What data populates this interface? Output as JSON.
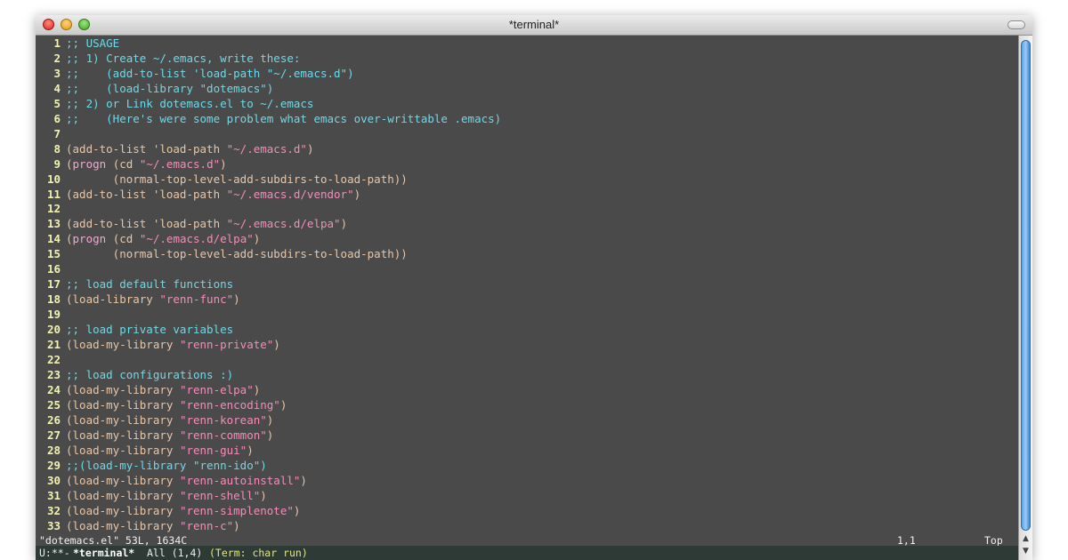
{
  "window": {
    "title": "*terminal*"
  },
  "lines": [
    {
      "n": "1",
      "segs": [
        {
          "t": ";; USAGE",
          "k": "c"
        }
      ]
    },
    {
      "n": "2",
      "segs": [
        {
          "t": ";; 1) Create ~/.emacs, write these:",
          "k": "c"
        }
      ]
    },
    {
      "n": "3",
      "segs": [
        {
          "t": ";;    (add-to-list 'load-path \"~/.emacs.d\")",
          "k": "c"
        }
      ]
    },
    {
      "n": "4",
      "segs": [
        {
          "t": ";;    (load-library \"dotemacs\")",
          "k": "c"
        }
      ]
    },
    {
      "n": "5",
      "segs": [
        {
          "t": ";; 2) or Link dotemacs.el to ~/.emacs",
          "k": "c"
        }
      ]
    },
    {
      "n": "6",
      "segs": [
        {
          "t": ";;    (Here's were some problem what emacs over-writtable .emacs)",
          "k": "c"
        }
      ]
    },
    {
      "n": "7",
      "segs": []
    },
    {
      "n": "8",
      "segs": [
        {
          "t": "(add-to-list 'load-path ",
          "k": "p"
        },
        {
          "t": "\"~/.emacs.d\"",
          "k": "s"
        },
        {
          "t": ")",
          "k": "p"
        }
      ]
    },
    {
      "n": "9",
      "segs": [
        {
          "t": "(",
          "k": "p"
        },
        {
          "t": "progn",
          "k": "k"
        },
        {
          "t": " (cd ",
          "k": "p"
        },
        {
          "t": "\"~/.emacs.d\"",
          "k": "s"
        },
        {
          "t": ")",
          "k": "p"
        }
      ]
    },
    {
      "n": "10",
      "segs": [
        {
          "t": "       (normal-top-level-add-subdirs-to-load-path))",
          "k": "p"
        }
      ]
    },
    {
      "n": "11",
      "segs": [
        {
          "t": "(add-to-list 'load-path ",
          "k": "p"
        },
        {
          "t": "\"~/.emacs.d/vendor\"",
          "k": "s"
        },
        {
          "t": ")",
          "k": "p"
        }
      ]
    },
    {
      "n": "12",
      "segs": []
    },
    {
      "n": "13",
      "segs": [
        {
          "t": "(add-to-list 'load-path ",
          "k": "p"
        },
        {
          "t": "\"~/.emacs.d/elpa\"",
          "k": "s"
        },
        {
          "t": ")",
          "k": "p"
        }
      ]
    },
    {
      "n": "14",
      "segs": [
        {
          "t": "(",
          "k": "p"
        },
        {
          "t": "progn",
          "k": "k"
        },
        {
          "t": " (cd ",
          "k": "p"
        },
        {
          "t": "\"~/.emacs.d/elpa\"",
          "k": "s"
        },
        {
          "t": ")",
          "k": "p"
        }
      ]
    },
    {
      "n": "15",
      "segs": [
        {
          "t": "       (normal-top-level-add-subdirs-to-load-path))",
          "k": "p"
        }
      ]
    },
    {
      "n": "16",
      "segs": []
    },
    {
      "n": "17",
      "segs": [
        {
          "t": ";; load default functions",
          "k": "c"
        }
      ]
    },
    {
      "n": "18",
      "segs": [
        {
          "t": "(load-library ",
          "k": "p"
        },
        {
          "t": "\"renn-func\"",
          "k": "s"
        },
        {
          "t": ")",
          "k": "p"
        }
      ]
    },
    {
      "n": "19",
      "segs": []
    },
    {
      "n": "20",
      "segs": [
        {
          "t": ";; load private variables",
          "k": "c"
        }
      ]
    },
    {
      "n": "21",
      "segs": [
        {
          "t": "(load-my-library ",
          "k": "p"
        },
        {
          "t": "\"renn-private\"",
          "k": "s"
        },
        {
          "t": ")",
          "k": "p"
        }
      ]
    },
    {
      "n": "22",
      "segs": []
    },
    {
      "n": "23",
      "segs": [
        {
          "t": ";; load configurations :)",
          "k": "c"
        }
      ]
    },
    {
      "n": "24",
      "segs": [
        {
          "t": "(load-my-library ",
          "k": "p"
        },
        {
          "t": "\"renn-elpa\"",
          "k": "s"
        },
        {
          "t": ")",
          "k": "p"
        }
      ]
    },
    {
      "n": "25",
      "segs": [
        {
          "t": "(load-my-library ",
          "k": "p"
        },
        {
          "t": "\"renn-encoding\"",
          "k": "s"
        },
        {
          "t": ")",
          "k": "p"
        }
      ]
    },
    {
      "n": "26",
      "segs": [
        {
          "t": "(load-my-library ",
          "k": "p"
        },
        {
          "t": "\"renn-korean\"",
          "k": "s"
        },
        {
          "t": ")",
          "k": "p"
        }
      ]
    },
    {
      "n": "27",
      "segs": [
        {
          "t": "(load-my-library ",
          "k": "p"
        },
        {
          "t": "\"renn-common\"",
          "k": "s"
        },
        {
          "t": ")",
          "k": "p"
        }
      ]
    },
    {
      "n": "28",
      "segs": [
        {
          "t": "(load-my-library ",
          "k": "p"
        },
        {
          "t": "\"renn-gui\"",
          "k": "s"
        },
        {
          "t": ")",
          "k": "p"
        }
      ]
    },
    {
      "n": "29",
      "segs": [
        {
          "t": ";;(load-my-library \"renn-ido\")",
          "k": "c"
        }
      ]
    },
    {
      "n": "30",
      "segs": [
        {
          "t": "(load-my-library ",
          "k": "p"
        },
        {
          "t": "\"renn-autoinstall\"",
          "k": "s"
        },
        {
          "t": ")",
          "k": "p"
        }
      ]
    },
    {
      "n": "31",
      "segs": [
        {
          "t": "(load-my-library ",
          "k": "p"
        },
        {
          "t": "\"renn-shell\"",
          "k": "s"
        },
        {
          "t": ")",
          "k": "p"
        }
      ]
    },
    {
      "n": "32",
      "segs": [
        {
          "t": "(load-my-library ",
          "k": "p"
        },
        {
          "t": "\"renn-simplenote\"",
          "k": "s"
        },
        {
          "t": ")",
          "k": "p"
        }
      ]
    },
    {
      "n": "33",
      "segs": [
        {
          "t": "(load-my-library ",
          "k": "p"
        },
        {
          "t": "\"renn-c\"",
          "k": "s"
        },
        {
          "t": ")",
          "k": "p"
        }
      ]
    }
  ],
  "echo": {
    "file_info": "\"dotemacs.el\" 53L, 1634C",
    "cursor_pos": "1,1",
    "scroll_pos": "Top"
  },
  "modeline": {
    "status": "U:**-",
    "buffer": "*terminal*",
    "position": "All (1,4)",
    "mode": "(Term: char run)"
  },
  "colors": {
    "comment": "#6fd8e8",
    "paren": "#e8c6a8",
    "string": "#f28db8",
    "line_number": "#f2f2b0",
    "background": "#4a4a4a"
  }
}
